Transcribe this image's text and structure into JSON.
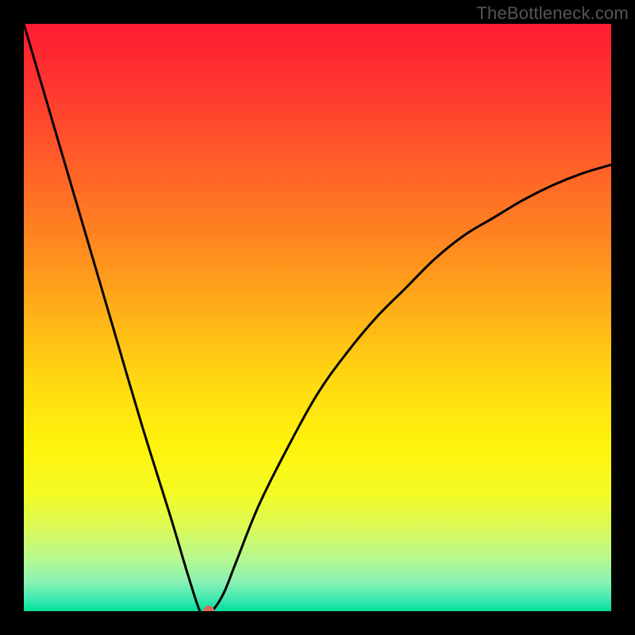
{
  "watermark": {
    "text": "TheBottleneck.com"
  },
  "chart_data": {
    "type": "line",
    "title": "",
    "xlabel": "",
    "ylabel": "",
    "xlim": [
      0,
      100
    ],
    "ylim": [
      0,
      100
    ],
    "grid": false,
    "series": [
      {
        "name": "bottleneck-curve",
        "x": [
          0,
          5,
          10,
          15,
          20,
          25,
          28,
          30,
          31,
          32,
          34,
          36,
          40,
          45,
          50,
          55,
          60,
          65,
          70,
          75,
          80,
          85,
          90,
          95,
          100
        ],
        "values": [
          100,
          83,
          66,
          49,
          32,
          16,
          6,
          0,
          0,
          0,
          3,
          8,
          18,
          28,
          37,
          44,
          50,
          55,
          60,
          64,
          67,
          70,
          72.5,
          74.5,
          76
        ]
      }
    ],
    "marker": {
      "x": 31.5,
      "y": 0,
      "color": "#d86a5a"
    },
    "background_gradient": {
      "stops": [
        {
          "offset": 0.0,
          "color": "#ff1b32"
        },
        {
          "offset": 0.12,
          "color": "#ff3a2f"
        },
        {
          "offset": 0.25,
          "color": "#ff6227"
        },
        {
          "offset": 0.38,
          "color": "#ff8a1f"
        },
        {
          "offset": 0.5,
          "color": "#ffb317"
        },
        {
          "offset": 0.62,
          "color": "#ffdc10"
        },
        {
          "offset": 0.72,
          "color": "#fff40c"
        },
        {
          "offset": 0.8,
          "color": "#f3fb24"
        },
        {
          "offset": 0.86,
          "color": "#d9fa5a"
        },
        {
          "offset": 0.91,
          "color": "#b8f88f"
        },
        {
          "offset": 0.95,
          "color": "#8af2b3"
        },
        {
          "offset": 0.98,
          "color": "#3de9b0"
        },
        {
          "offset": 1.0,
          "color": "#00df9a"
        }
      ]
    },
    "line_color": "#000000",
    "line_width": 3
  }
}
